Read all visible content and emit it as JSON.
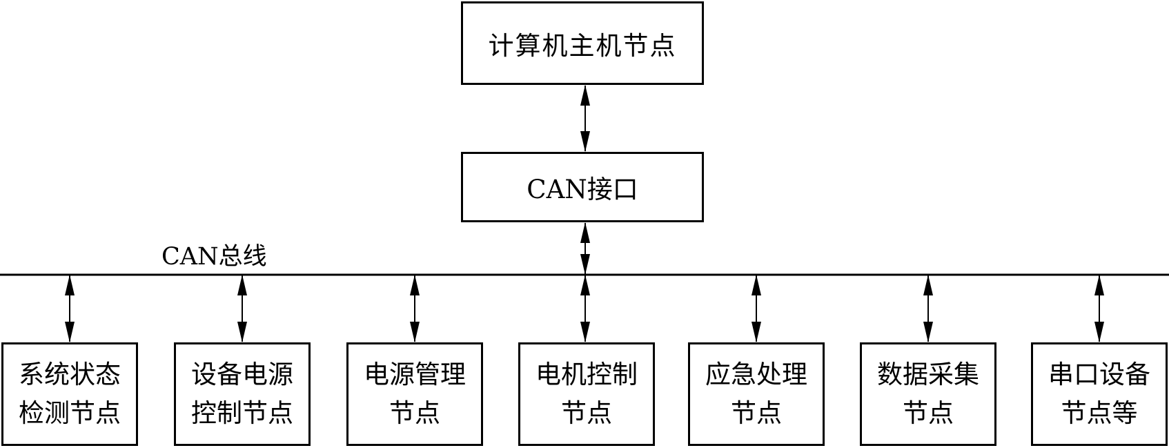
{
  "diagram": {
    "host_node": {
      "label": "计算机主机节点"
    },
    "interface": {
      "label": "CAN接口"
    },
    "bus": {
      "label": "CAN总线"
    },
    "nodes": [
      {
        "line1": "系统状态",
        "line2": "检测节点"
      },
      {
        "line1": "设备电源",
        "line2": "控制节点"
      },
      {
        "line1": "电源管理",
        "line2": "节点"
      },
      {
        "line1": "电机控制",
        "line2": "节点"
      },
      {
        "line1": "应急处理",
        "line2": "节点"
      },
      {
        "line1": "数据采集",
        "line2": "节点"
      },
      {
        "line1": "串口设备",
        "line2": "节点等"
      }
    ],
    "edges": [
      {
        "from": "host_node",
        "to": "interface",
        "type": "bidirectional"
      },
      {
        "from": "interface",
        "to": "bus",
        "type": "bidirectional"
      },
      {
        "from": "bus",
        "to": "nodes.0",
        "type": "bidirectional"
      },
      {
        "from": "bus",
        "to": "nodes.1",
        "type": "bidirectional"
      },
      {
        "from": "bus",
        "to": "nodes.2",
        "type": "bidirectional"
      },
      {
        "from": "bus",
        "to": "nodes.3",
        "type": "bidirectional"
      },
      {
        "from": "bus",
        "to": "nodes.4",
        "type": "bidirectional"
      },
      {
        "from": "bus",
        "to": "nodes.5",
        "type": "bidirectional"
      },
      {
        "from": "bus",
        "to": "nodes.6",
        "type": "bidirectional"
      }
    ]
  }
}
